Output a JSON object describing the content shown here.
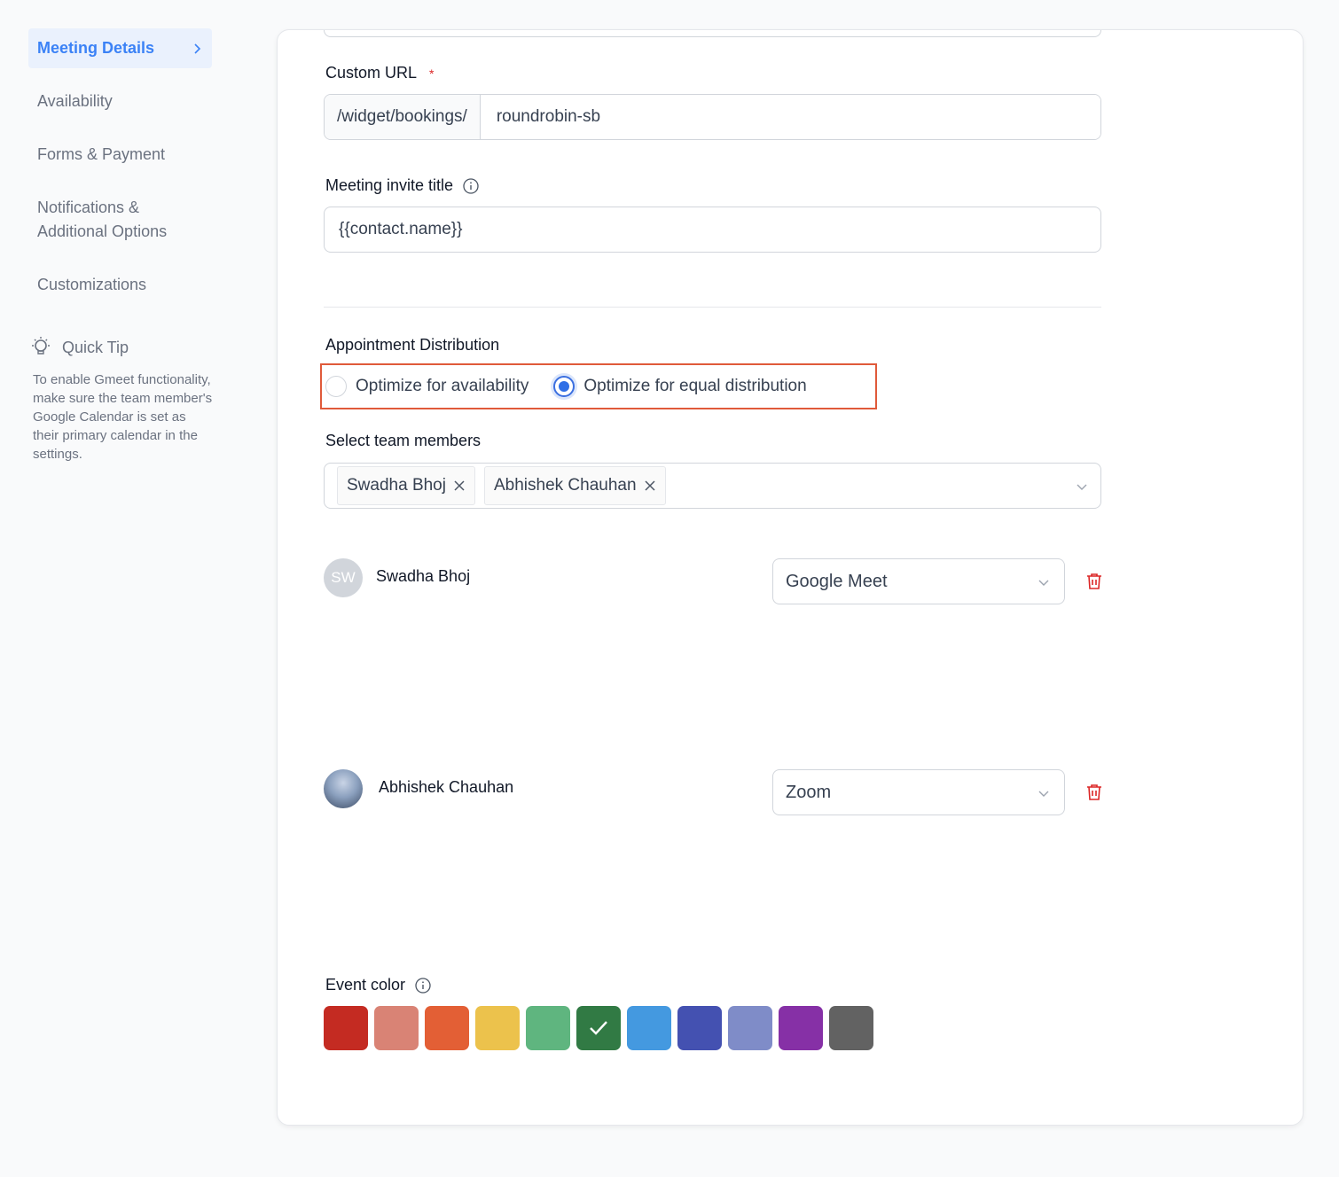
{
  "sidebar": {
    "items": [
      {
        "label": "Meeting Details",
        "active": true
      },
      {
        "label": "Availability"
      },
      {
        "label": "Forms & Payment"
      },
      {
        "label": "Notifications & Additional Options"
      },
      {
        "label": "Customizations"
      }
    ],
    "tip": {
      "title": "Quick Tip",
      "body": "To enable Gmeet functionality, make sure the team member's Google Calendar is set as their primary calendar in the settings."
    }
  },
  "form": {
    "custom_url": {
      "label": "Custom URL",
      "required_mark": "*",
      "prefix": "/widget/bookings/",
      "value": "roundrobin-sb"
    },
    "invite_title": {
      "label": "Meeting invite title",
      "value": "{{contact.name}}"
    },
    "distribution": {
      "label": "Appointment Distribution",
      "options": [
        {
          "label": "Optimize for availability",
          "checked": false
        },
        {
          "label": "Optimize for equal distribution",
          "checked": true
        }
      ]
    },
    "team": {
      "label": "Select team members",
      "chips": [
        "Swadha Bhoj",
        "Abhishek Chauhan"
      ],
      "members": [
        {
          "initials": "SW",
          "name": "Swadha Bhoj",
          "location": "Google Meet"
        },
        {
          "initials": "",
          "name": "Abhishek Chauhan",
          "location": "Zoom"
        }
      ]
    },
    "event_color": {
      "label": "Event color",
      "colors": [
        "#c42b22",
        "#d98375",
        "#e35f35",
        "#ecc24c",
        "#5fb57f",
        "#317a44",
        "#4499e0",
        "#4451b1",
        "#7f8cc8",
        "#8630a6",
        "#626262"
      ],
      "selected_index": 5
    }
  },
  "colors": {
    "accent": "#3b82f6",
    "danger": "#dc2626",
    "highlight_border": "#e05a3a"
  }
}
